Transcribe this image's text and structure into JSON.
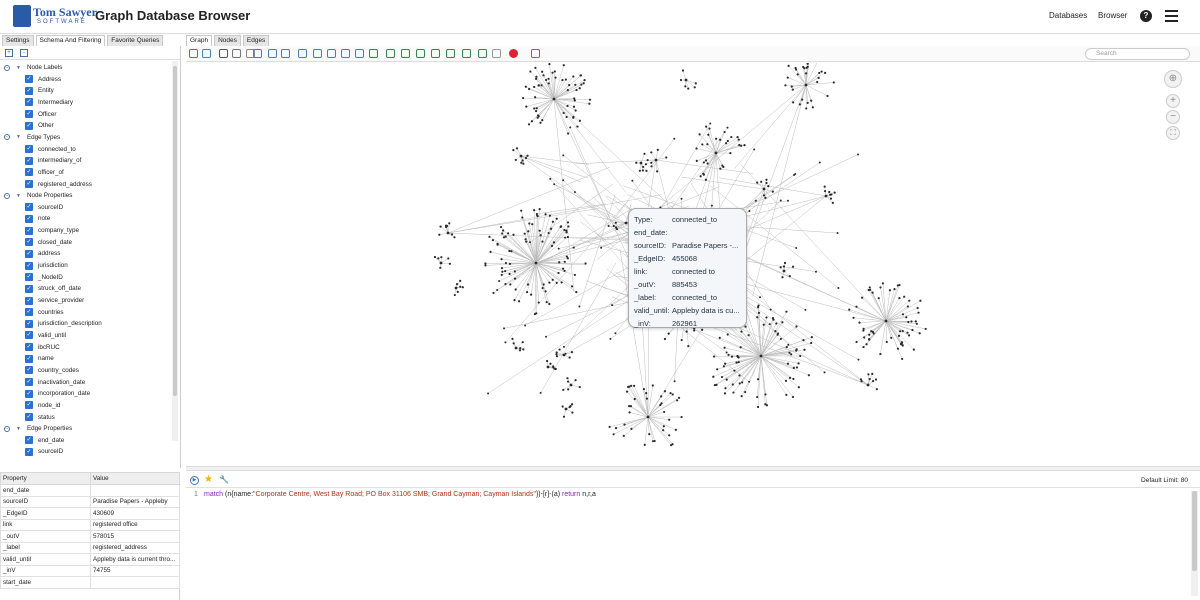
{
  "header": {
    "logo_line1": "Tom Sawyer",
    "logo_line2": "SOFTWARE",
    "title": "Graph Database Browser",
    "nav_databases": "Databases",
    "nav_browser": "Browser",
    "help_glyph": "?"
  },
  "left_tabs": [
    "Settings",
    "Schema And Filtering",
    "Favorite Queries"
  ],
  "graph_tabs": [
    "Graph",
    "Nodes",
    "Edges"
  ],
  "tree": [
    {
      "type": "group",
      "label": "Node Labels"
    },
    {
      "type": "item",
      "label": "Address"
    },
    {
      "type": "item",
      "label": "Entity"
    },
    {
      "type": "item",
      "label": "Intermediary"
    },
    {
      "type": "item",
      "label": "Officer"
    },
    {
      "type": "item",
      "label": "Other"
    },
    {
      "type": "group",
      "label": "Edge Types"
    },
    {
      "type": "item",
      "label": "connected_to"
    },
    {
      "type": "item",
      "label": "intermediary_of"
    },
    {
      "type": "item",
      "label": "officer_of"
    },
    {
      "type": "item",
      "label": "registered_address"
    },
    {
      "type": "group",
      "label": "Node Properties"
    },
    {
      "type": "item",
      "label": "sourceID"
    },
    {
      "type": "item",
      "label": "note"
    },
    {
      "type": "item",
      "label": "company_type"
    },
    {
      "type": "item",
      "label": "closed_date"
    },
    {
      "type": "item",
      "label": "address"
    },
    {
      "type": "item",
      "label": "jurisdiction"
    },
    {
      "type": "item",
      "label": "_NodeID"
    },
    {
      "type": "item",
      "label": "struck_off_date"
    },
    {
      "type": "item",
      "label": "service_provider"
    },
    {
      "type": "item",
      "label": "countries"
    },
    {
      "type": "item",
      "label": "jurisdiction_description"
    },
    {
      "type": "item",
      "label": "valid_until"
    },
    {
      "type": "item",
      "label": "ibcRUC"
    },
    {
      "type": "item",
      "label": "name"
    },
    {
      "type": "item",
      "label": "country_codes"
    },
    {
      "type": "item",
      "label": "inactivation_date"
    },
    {
      "type": "item",
      "label": "incorporation_date"
    },
    {
      "type": "item",
      "label": "node_id"
    },
    {
      "type": "item",
      "label": "status"
    },
    {
      "type": "group",
      "label": "Edge Properties"
    },
    {
      "type": "item",
      "label": "end_date"
    },
    {
      "type": "item",
      "label": "sourceID"
    }
  ],
  "properties": {
    "headers": [
      "Property",
      "Value"
    ],
    "rows": [
      [
        "end_date",
        ""
      ],
      [
        "sourceID",
        "Paradise Papers - Appleby"
      ],
      [
        "_EdgeID",
        "430609"
      ],
      [
        "link",
        "registered office"
      ],
      [
        "_outV",
        "578015"
      ],
      [
        "_label",
        "registered_address"
      ],
      [
        "valid_until",
        "Appleby data is current thro..."
      ],
      [
        "_inV",
        "74755"
      ],
      [
        "start_date",
        ""
      ]
    ]
  },
  "search": {
    "placeholder": "Search"
  },
  "tooltip": [
    {
      "k": "Type:",
      "v": "connected_to"
    },
    {
      "k": "end_date:",
      "v": ""
    },
    {
      "k": "sourceID:",
      "v": "Paradise Papers -..."
    },
    {
      "k": "_EdgeID:",
      "v": "455068"
    },
    {
      "k": "link:",
      "v": "connected to"
    },
    {
      "k": "_outV:",
      "v": "885453"
    },
    {
      "k": "_label:",
      "v": "connected_to"
    },
    {
      "k": "valid_until:",
      "v": "Appleby data is cu..."
    },
    {
      "k": "_inV:",
      "v": "262961"
    }
  ],
  "query": {
    "line_number": "1",
    "kw_match": "match",
    "part1": " (n{name:",
    "string_value": "\"Corporate Centre, West Bay Road; PO Box 31106 SMB; Grand Cayman; Cayman Islands\"",
    "part2": "})-[r]-(a) ",
    "kw_return": "return",
    "part3": " n,r,a"
  },
  "default_limit": "Default Limit: 80",
  "colors": {
    "accent": "#2a71d0",
    "node": "#2b2b2b",
    "edge": "#bdbdbd"
  }
}
